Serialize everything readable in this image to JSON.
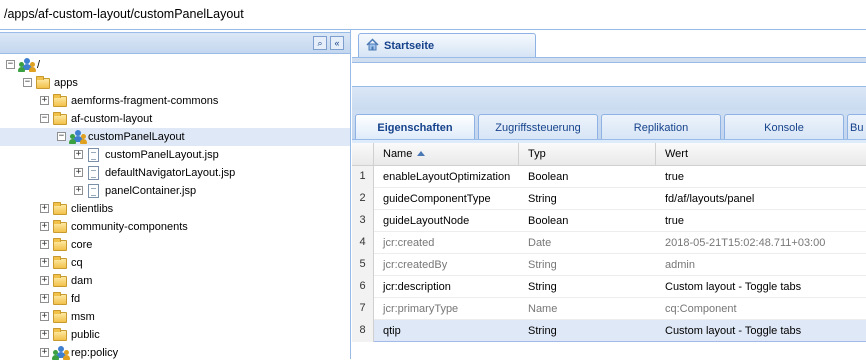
{
  "path": "/apps/af-custom-layout/customPanelLayout",
  "tree": [
    {
      "label": "/",
      "icon": "users-icon",
      "toggle": "−",
      "level": 0
    },
    {
      "label": "apps",
      "icon": "folder-icon",
      "toggle": "−",
      "level": 1
    },
    {
      "label": "aemforms-fragment-commons",
      "icon": "folder-icon",
      "toggle": "+",
      "level": 2
    },
    {
      "label": "af-custom-layout",
      "icon": "folder-icon",
      "toggle": "−",
      "level": 2
    },
    {
      "label": "customPanelLayout",
      "icon": "users-icon",
      "toggle": "−",
      "level": 3,
      "selected": true
    },
    {
      "label": "customPanelLayout.jsp",
      "icon": "file-icon",
      "toggle": "+",
      "level": 4
    },
    {
      "label": "defaultNavigatorLayout.jsp",
      "icon": "file-icon",
      "toggle": "+",
      "level": 4
    },
    {
      "label": "panelContainer.jsp",
      "icon": "file-icon",
      "toggle": "+",
      "level": 4
    },
    {
      "label": "clientlibs",
      "icon": "folder-icon",
      "toggle": "+",
      "level": 2
    },
    {
      "label": "community-components",
      "icon": "folder-icon",
      "toggle": "+",
      "level": 2
    },
    {
      "label": "core",
      "icon": "folder-icon",
      "toggle": "+",
      "level": 2
    },
    {
      "label": "cq",
      "icon": "folder-icon",
      "toggle": "+",
      "level": 2
    },
    {
      "label": "dam",
      "icon": "folder-icon",
      "toggle": "+",
      "level": 2
    },
    {
      "label": "fd",
      "icon": "folder-icon",
      "toggle": "+",
      "level": 2
    },
    {
      "label": "msm",
      "icon": "folder-icon",
      "toggle": "+",
      "level": 2
    },
    {
      "label": "public",
      "icon": "folder-icon",
      "toggle": "+",
      "level": 2
    },
    {
      "label": "rep:policy",
      "icon": "users-icon",
      "toggle": "+",
      "level": 2
    }
  ],
  "start_tab": "Startseite",
  "prop_tabs": [
    "Eigenschaften",
    "Zugriffssteuerung",
    "Replikation",
    "Konsole",
    "Bu"
  ],
  "columns": {
    "name": "Name",
    "type": "Typ",
    "value": "Wert"
  },
  "rows": [
    {
      "n": "1",
      "name": "enableLayoutOptimization",
      "type": "Boolean",
      "value": "true",
      "grey": false
    },
    {
      "n": "2",
      "name": "guideComponentType",
      "type": "String",
      "value": "fd/af/layouts/panel",
      "grey": false
    },
    {
      "n": "3",
      "name": "guideLayoutNode",
      "type": "Boolean",
      "value": "true",
      "grey": false
    },
    {
      "n": "4",
      "name": "jcr:created",
      "type": "Date",
      "value": "2018-05-21T15:02:48.711+03:00",
      "grey": true
    },
    {
      "n": "5",
      "name": "jcr:createdBy",
      "type": "String",
      "value": "admin",
      "grey": true
    },
    {
      "n": "6",
      "name": "jcr:description",
      "type": "String",
      "value": "Custom layout - Toggle tabs",
      "grey": false
    },
    {
      "n": "7",
      "name": "jcr:primaryType",
      "type": "Name",
      "value": "cq:Component",
      "grey": true
    },
    {
      "n": "8",
      "name": "qtip",
      "type": "String",
      "value": "Custom layout - Toggle tabs",
      "grey": false,
      "selected": true
    }
  ]
}
